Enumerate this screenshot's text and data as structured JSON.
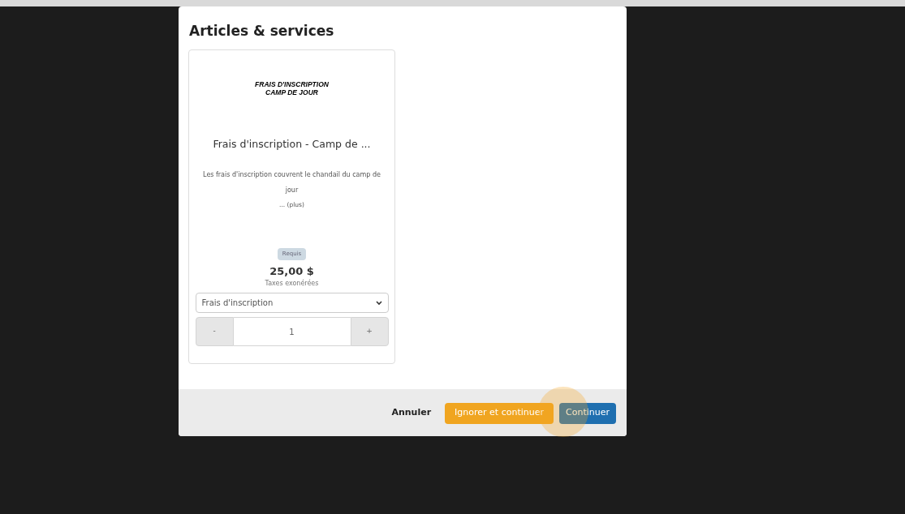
{
  "dialog": {
    "title": "Articles & services",
    "items": [
      {
        "image_text": [
          "FRAIS D'INSCRIPTION",
          "CAMP DE JOUR"
        ],
        "name": "Frais d'inscription - Camp de ...",
        "description": "Les frais d'inscription couvrent le chandail du camp de jour",
        "more_link": "... (plus)",
        "badge": "Requis",
        "price": "25,00 $",
        "tax_note": "Taxes exonérées",
        "option": "Frais d'inscription",
        "decrement": "-",
        "quantity": "1",
        "increment": "+"
      }
    ],
    "buttons": [
      {
        "label": "Annuler",
        "kind": "link",
        "highlighted": false
      },
      {
        "label": "Ignorer et continuer",
        "kind": "warning",
        "highlighted": false
      },
      {
        "label": "Continuer",
        "kind": "primary",
        "highlighted": true
      }
    ]
  }
}
